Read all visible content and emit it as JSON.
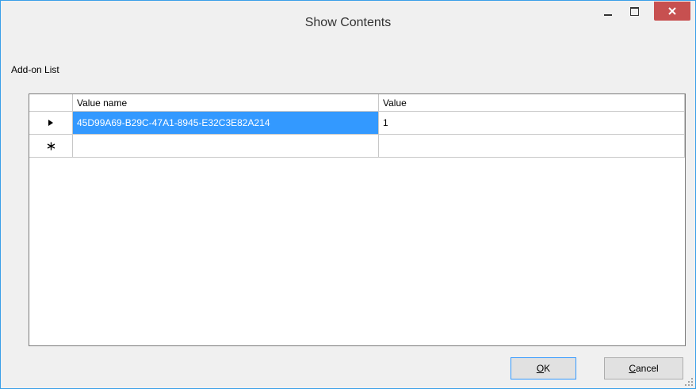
{
  "window": {
    "title": "Show Contents"
  },
  "caption": "Add-on List",
  "grid": {
    "columns": [
      "Value name",
      "Value"
    ],
    "rows": [
      {
        "indicator": "current-row",
        "value_name": "45D99A69-B29C-47A1-8945-E32C3E82A214",
        "value": "1"
      },
      {
        "indicator": "new-row",
        "value_name": "",
        "value": ""
      }
    ]
  },
  "buttons": {
    "ok_mnemonic": "O",
    "ok_rest": "K",
    "cancel_mnemonic": "C",
    "cancel_rest": "ancel"
  },
  "colors": {
    "accent": "#3399ff",
    "close": "#c75050",
    "border": "#3a9fe8"
  }
}
